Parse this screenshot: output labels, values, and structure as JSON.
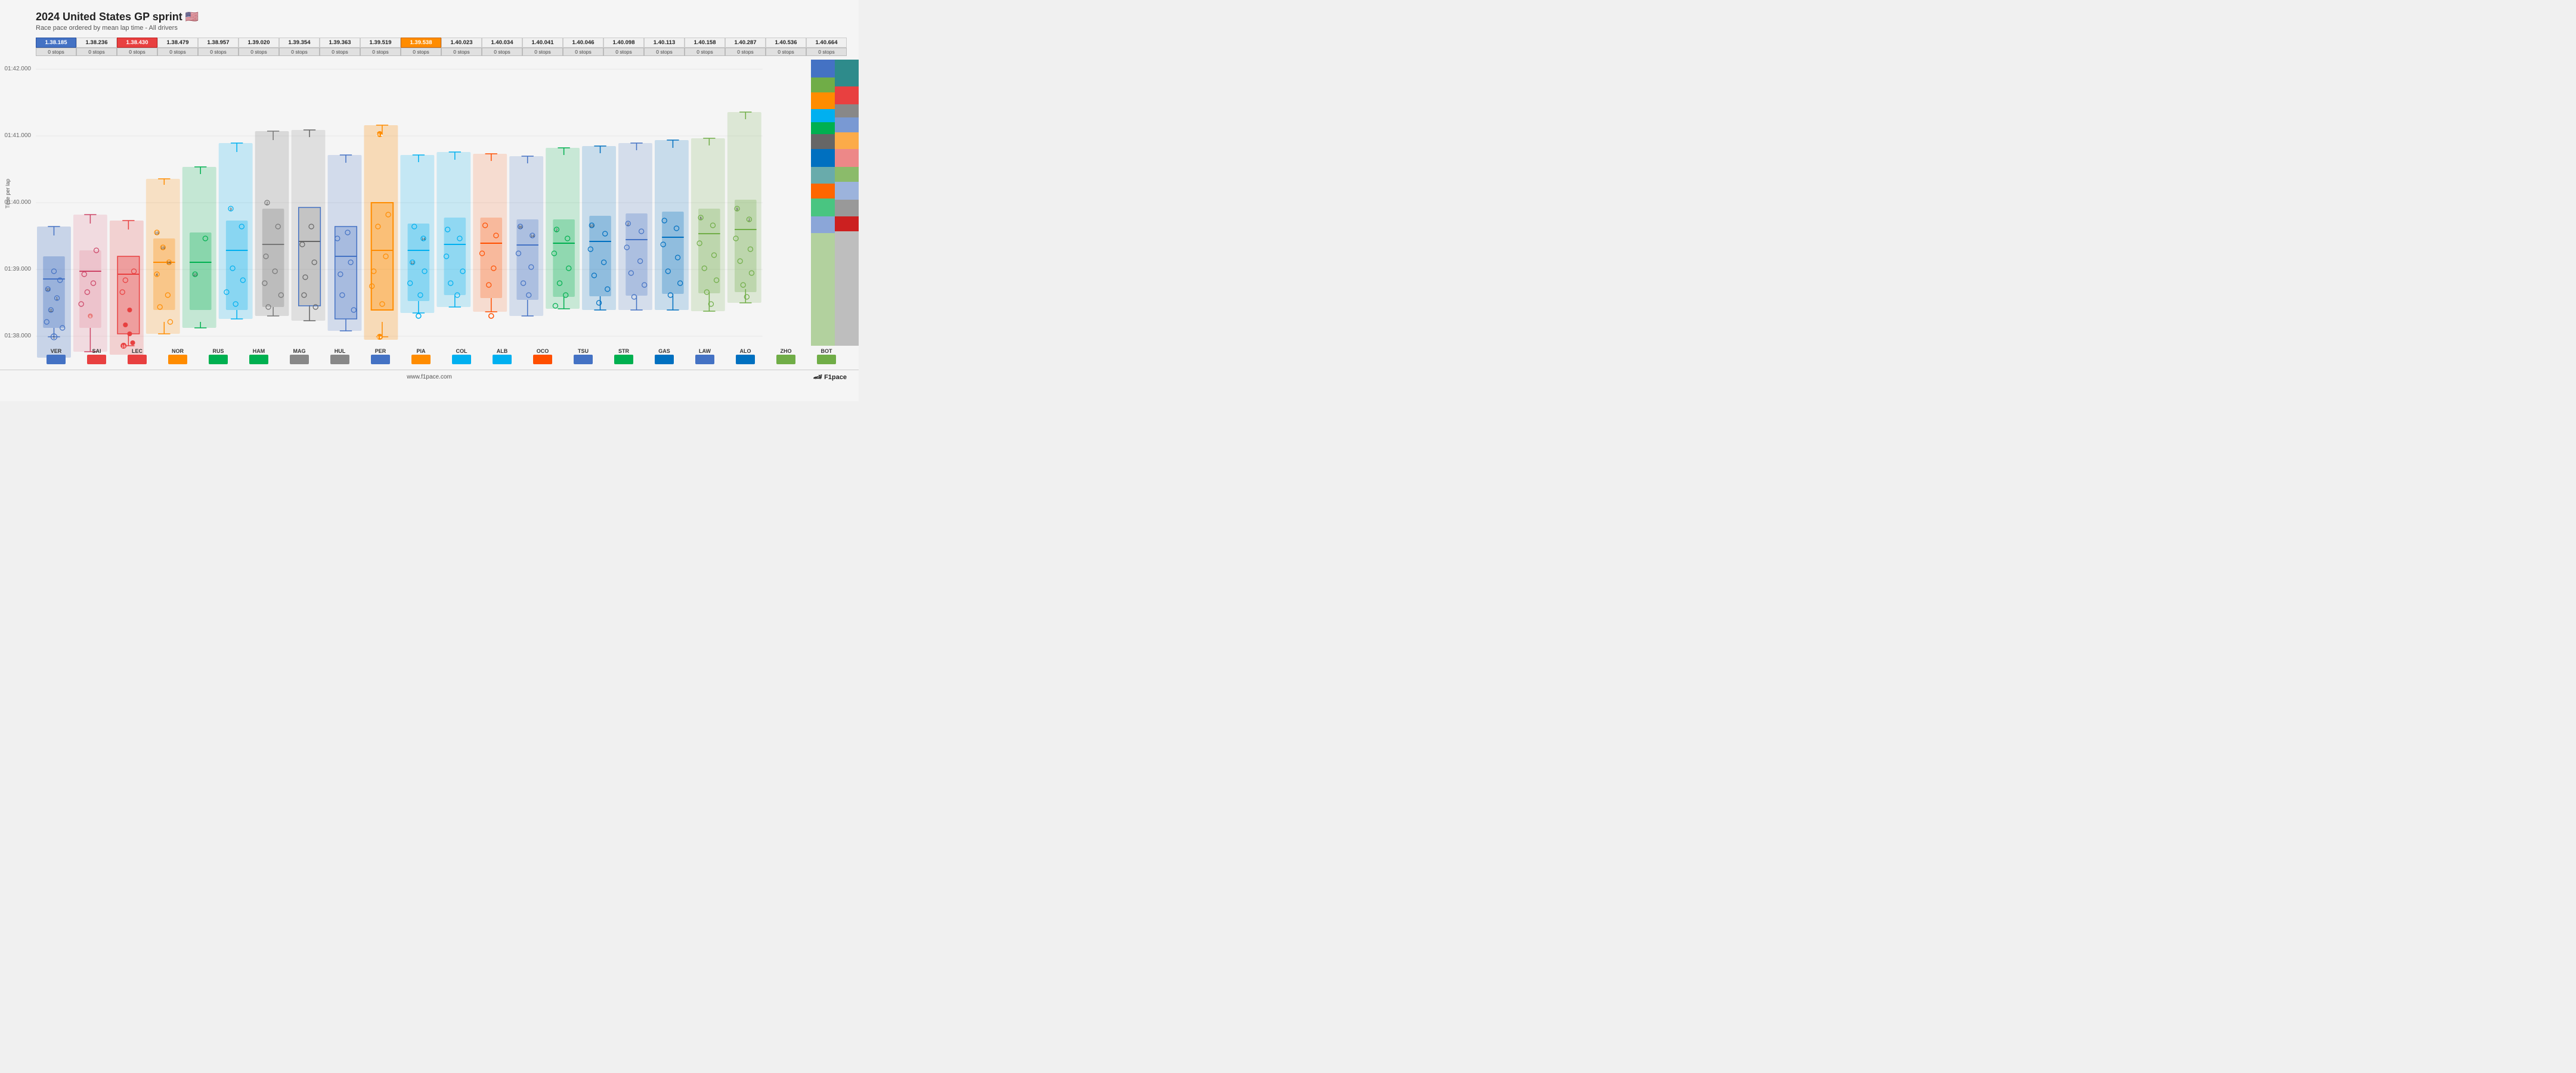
{
  "title": "2024 United States GP sprint 🇺🇸",
  "subtitle": "Race pace ordered by mean lap time - All drivers",
  "footer_url": "www.f1pace.com",
  "footer_brand": "F1pace",
  "y_axis_label": "Time per lap",
  "y_ticks": [
    "01:42.000",
    "01:41.000",
    "01:40.000",
    "01:39.000",
    "01:38.000"
  ],
  "drivers": [
    {
      "code": "VER",
      "mean": "1.38.185",
      "stops": "0 stops",
      "highlight": "blue"
    },
    {
      "code": "SAI",
      "mean": "1.38.236",
      "stops": "0 stops",
      "highlight": "none"
    },
    {
      "code": "LEC",
      "mean": "1.38.430",
      "stops": "0 stops",
      "highlight": "red"
    },
    {
      "code": "NOR",
      "mean": "1.38.479",
      "stops": "0 stops",
      "highlight": "none"
    },
    {
      "code": "RUS",
      "mean": "1.38.957",
      "stops": "0 stops",
      "highlight": "none"
    },
    {
      "code": "HAM",
      "mean": "1.39.020",
      "stops": "0 stops",
      "highlight": "none"
    },
    {
      "code": "MAG",
      "mean": "1.39.354",
      "stops": "0 stops",
      "highlight": "none"
    },
    {
      "code": "HUL",
      "mean": "1.39.363",
      "stops": "0 stops",
      "highlight": "none"
    },
    {
      "code": "PER",
      "mean": "1.39.519",
      "stops": "0 stops",
      "highlight": "none"
    },
    {
      "code": "PIA",
      "mean": "1.39.538",
      "stops": "0 stops",
      "highlight": "orange"
    },
    {
      "code": "COL",
      "mean": "1.40.023",
      "stops": "0 stops",
      "highlight": "none"
    },
    {
      "code": "ALB",
      "mean": "1.40.034",
      "stops": "0 stops",
      "highlight": "none"
    },
    {
      "code": "OCO",
      "mean": "1.40.041",
      "stops": "0 stops",
      "highlight": "none"
    },
    {
      "code": "TSU",
      "mean": "1.40.046",
      "stops": "0 stops",
      "highlight": "none"
    },
    {
      "code": "STR",
      "mean": "1.40.098",
      "stops": "0 stops",
      "highlight": "none"
    },
    {
      "code": "GAS",
      "mean": "1.40.113",
      "stops": "0 stops",
      "highlight": "none"
    },
    {
      "code": "LAW",
      "mean": "1.40.158",
      "stops": "0 stops",
      "highlight": "none"
    },
    {
      "code": "ALO",
      "mean": "1.40.287",
      "stops": "0 stops",
      "highlight": "none"
    },
    {
      "code": "ZHO",
      "mean": "1.40.536",
      "stops": "0 stops",
      "highlight": "none"
    },
    {
      "code": "BOT",
      "mean": "1.40.664",
      "stops": "0 stops",
      "highlight": "none"
    }
  ]
}
